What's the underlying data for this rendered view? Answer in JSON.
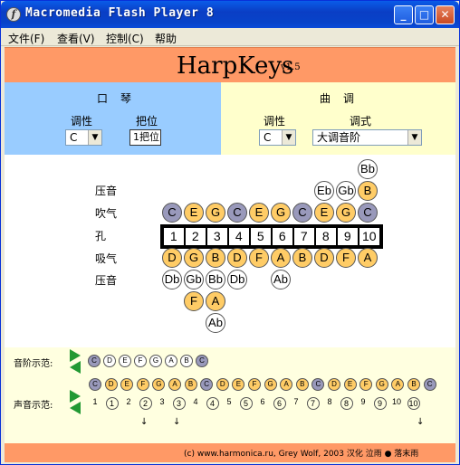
{
  "window": {
    "title": "Macromedia Flash Player 8",
    "icon": "f",
    "btn_min": "_",
    "btn_max": "□",
    "btn_close": "✕"
  },
  "menu": [
    "文件(F)",
    "查看(V)",
    "控制(C)",
    "帮助"
  ],
  "app": {
    "title": "HarpKeys",
    "version": "v1.5"
  },
  "harmonica": {
    "title": "口琴",
    "key_label": "调性",
    "key_value": "C",
    "position_label": "把位",
    "position_value": "1把位"
  },
  "tune": {
    "title": "曲调",
    "key_label": "调性",
    "key_value": "C",
    "mode_label": "调式",
    "mode_value": "大调音阶"
  },
  "rows": {
    "bend_top": "压音",
    "blow": "吹气",
    "holes": "孔",
    "draw": "吸气",
    "bend_bottom": "压音"
  },
  "icons": {
    "arrow": "▼",
    "down_arrow": "↓"
  },
  "blow_bends": {
    "row2": [
      "Bb"
    ],
    "row1": [
      "Eb",
      "Gb",
      "B"
    ]
  },
  "blow_notes": [
    "C",
    "E",
    "G",
    "C",
    "E",
    "G",
    "C",
    "E",
    "G",
    "C"
  ],
  "blow_colors": [
    "gray",
    "orange",
    "orange",
    "gray",
    "orange",
    "orange",
    "gray",
    "orange",
    "orange",
    "gray"
  ],
  "hole_numbers": [
    "1",
    "2",
    "3",
    "4",
    "5",
    "6",
    "7",
    "8",
    "9",
    "10"
  ],
  "draw_notes": [
    "D",
    "G",
    "B",
    "D",
    "F",
    "A",
    "B",
    "D",
    "F",
    "A"
  ],
  "draw_colors": [
    "orange",
    "orange",
    "orange",
    "orange",
    "orange",
    "orange",
    "orange",
    "orange",
    "orange",
    "orange"
  ],
  "draw_bends": {
    "row1": [
      "Db",
      "Gb",
      "Bb",
      "Db",
      "Ab"
    ],
    "row2": [
      "F",
      "A"
    ],
    "row3": [
      "Ab"
    ]
  },
  "scale_demo": {
    "label": "音阶示范:",
    "notes": [
      "C",
      "D",
      "E",
      "F",
      "G",
      "A",
      "B",
      "C"
    ]
  },
  "sound_demo": {
    "label": "声音示范:",
    "notes": [
      "C",
      "D",
      "E",
      "F",
      "G",
      "A",
      "B",
      "C",
      "D",
      "E",
      "F",
      "G",
      "A",
      "B",
      "C",
      "D",
      "E",
      "F",
      "G",
      "A",
      "B",
      "C"
    ],
    "holes": [
      "1",
      "1",
      "2",
      "2",
      "3",
      "3",
      "4",
      "4",
      "5",
      "5",
      "6",
      "6",
      "7",
      "7",
      "8",
      "8",
      "9",
      "9",
      "10",
      "10"
    ]
  },
  "footer": "(c) www.harmonica.ru, Grey Wolf, 2003    汉化 泣雨 ● 落末雨"
}
